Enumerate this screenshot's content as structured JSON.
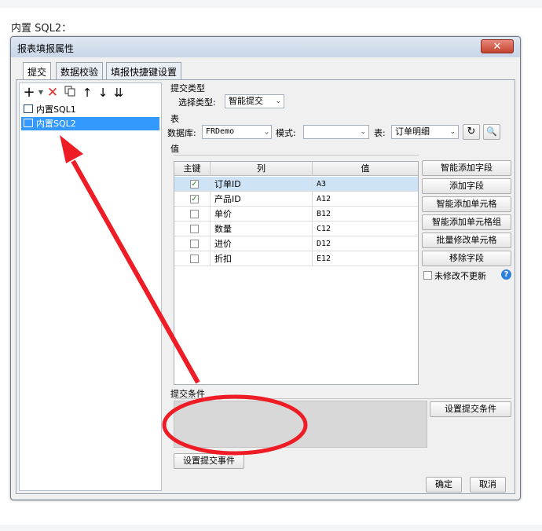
{
  "page": {
    "heading": "内置 SQL2："
  },
  "dialog": {
    "title": "报表填报属性",
    "close_glyph": "✕"
  },
  "tabs": [
    {
      "label": "提交",
      "active": true
    },
    {
      "label": "数据校验",
      "active": false
    },
    {
      "label": "填报快捷键设置",
      "active": false
    }
  ],
  "toolbar": {
    "add_icon": "plus-icon",
    "delete_icon": "delete-x-icon",
    "copy_icon": "copy-icon",
    "up_icon": "arrow-up-icon",
    "down_icon": "arrow-down-icon",
    "sort_icon": "sort-icon"
  },
  "tree": {
    "items": [
      {
        "label": "内置SQL1",
        "selected": false
      },
      {
        "label": "内置SQL2",
        "selected": true
      }
    ]
  },
  "submit_type": {
    "section_label": "提交类型",
    "select_label": "选择类型:",
    "value": "智能提交"
  },
  "table_section": {
    "section_label": "表",
    "database_label": "数据库:",
    "database_value": "FRDemo",
    "mode_label": "模式:",
    "mode_value": "",
    "table_label": "表:",
    "table_value": "订单明细"
  },
  "values_section": {
    "section_label": "值",
    "columns": [
      "主键",
      "列",
      "值"
    ],
    "rows": [
      {
        "key": true,
        "column": "订单ID",
        "value": "A3"
      },
      {
        "key": true,
        "column": "产品ID",
        "value": "A12"
      },
      {
        "key": false,
        "column": "单价",
        "value": "B12"
      },
      {
        "key": false,
        "column": "数量",
        "value": "C12"
      },
      {
        "key": false,
        "column": "进价",
        "value": "D12"
      },
      {
        "key": false,
        "column": "折扣",
        "value": "E12"
      }
    ]
  },
  "side_buttons": {
    "smart_add_field": "智能添加字段",
    "add_field": "添加字段",
    "smart_add_cell": "智能添加单元格",
    "smart_add_cell_group": "智能添加单元格组",
    "batch_modify_cell": "批量修改单元格",
    "remove_field": "移除字段",
    "no_update_label": "未修改不更新",
    "help_glyph": "?"
  },
  "condition": {
    "section_label": "提交条件",
    "set_button": "设置提交条件"
  },
  "event_button": "设置提交事件",
  "footer": {
    "ok": "确定",
    "cancel": "取消"
  },
  "colors": {
    "arrow": "#ee1c25",
    "selection": "#3399ff"
  }
}
